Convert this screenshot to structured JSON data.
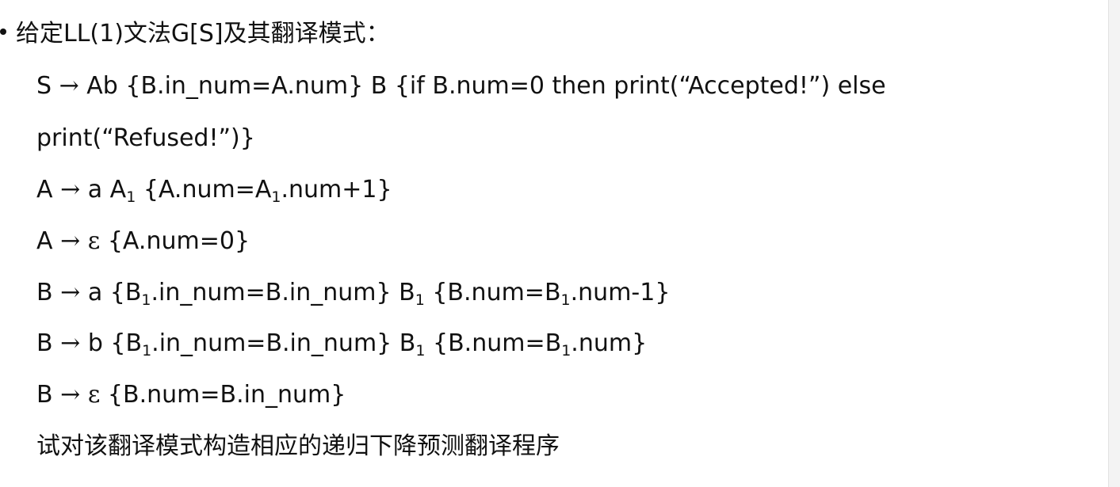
{
  "heading": "给定LL(1)文法G[S]及其翻译模式：",
  "arrow": "→",
  "epsilon": "ε",
  "sub1": "1",
  "rule_S": {
    "lhs": "S",
    "line1": "Ab {B.in_num=A.num} B {if B.num=0 then print(“Accepted!”) else",
    "line2": "print(“Refused!”)}"
  },
  "rule_A1": {
    "lhs": "A",
    "p1": "a A",
    "p2": " {A.num=A",
    "p3": ".num+1}"
  },
  "rule_A2": {
    "lhs": "A",
    "p1": " {A.num=0}"
  },
  "rule_B1": {
    "lhs": "B",
    "p1": "a {B",
    "p2": ".in_num=B.in_num} B",
    "p3": " {B.num=B",
    "p4": ".num-1}"
  },
  "rule_B2": {
    "lhs": "B",
    "p1": "b {B",
    "p2": ".in_num=B.in_num} B",
    "p3": " {B.num=B",
    "p4": ".num}"
  },
  "rule_B3": {
    "lhs": "B",
    "p1": " {B.num=B.in_num}"
  },
  "question": "试对该翻译模式构造相应的递归下降预测翻译程序"
}
